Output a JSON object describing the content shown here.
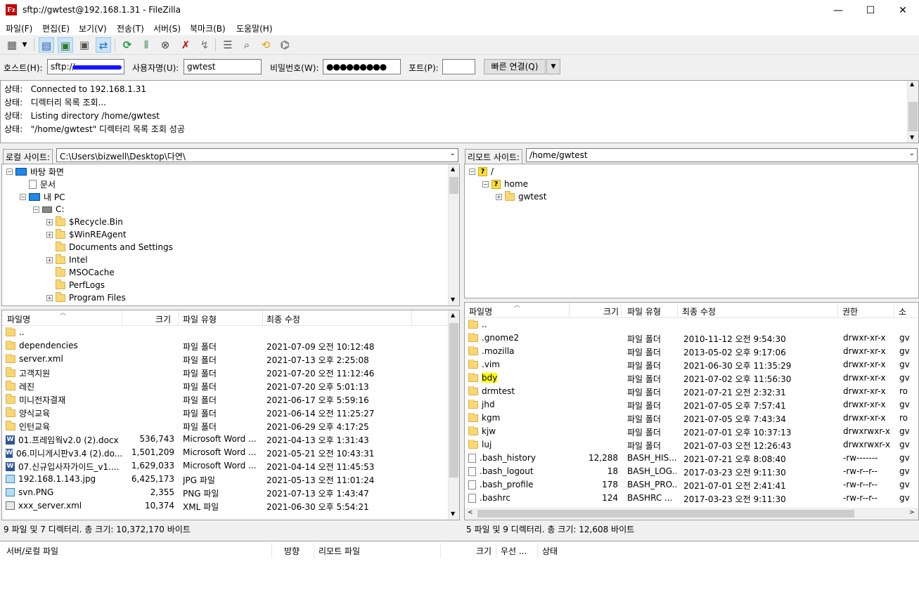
{
  "window": {
    "title": "sftp://gwtest@192.168.1.31 - FileZilla",
    "app_icon": "Fz",
    "minimize": "—",
    "maximize": "☐",
    "close": "✕"
  },
  "menu": [
    "파일(F)",
    "편집(E)",
    "보기(V)",
    "전송(T)",
    "서버(S)",
    "북마크(B)",
    "도움말(H)"
  ],
  "toolbar": [
    "site-manager-icon",
    "dropdown-icon",
    "message-log-icon",
    "local-tree-icon",
    "remote-tree-icon",
    "transfer-queue-icon",
    "refresh-icon",
    "process-queue-icon",
    "cancel-icon",
    "disconnect-icon",
    "reconnect-icon",
    "filter-icon",
    "compare-icon",
    "sync-browse-icon",
    "find-icon"
  ],
  "quickconnect": {
    "host_label": "호스트(H):",
    "host_value": "sftp://",
    "user_label": "사용자명(U):",
    "user_value": "gwtest",
    "pass_label": "비밀번호(W):",
    "pass_value": "●●●●●●●●●",
    "port_label": "포트(P):",
    "port_value": "",
    "button": "빠른 연결(Q)"
  },
  "log": [
    {
      "label": "상태:",
      "text": "Connected to 192.168.1.31"
    },
    {
      "label": "상태:",
      "text": "디렉터리 목록 조회..."
    },
    {
      "label": "상태:",
      "text": "Listing directory /home/gwtest"
    },
    {
      "label": "상태:",
      "text": "\"/home/gwtest\" 디렉터리 목록 조회 성공"
    }
  ],
  "local": {
    "site_label": "로컬 사이트:",
    "path": "C:\\Users\\bizwell\\Desktop\\다연\\",
    "tree": [
      {
        "label": "바탕 화면",
        "icon": "monitor",
        "indent": 0,
        "exp": "−"
      },
      {
        "label": "문서",
        "icon": "file",
        "indent": 1,
        "exp": ""
      },
      {
        "label": "내 PC",
        "icon": "monitor",
        "indent": 1,
        "exp": "−"
      },
      {
        "label": "C:",
        "icon": "drive",
        "indent": 2,
        "exp": "−"
      },
      {
        "label": "$Recycle.Bin",
        "icon": "folder",
        "indent": 3,
        "exp": "+"
      },
      {
        "label": "$WinREAgent",
        "icon": "folder",
        "indent": 3,
        "exp": "+"
      },
      {
        "label": "Documents and Settings",
        "icon": "folder",
        "indent": 3,
        "exp": ""
      },
      {
        "label": "Intel",
        "icon": "folder",
        "indent": 3,
        "exp": "+"
      },
      {
        "label": "MSOCache",
        "icon": "folder",
        "indent": 3,
        "exp": ""
      },
      {
        "label": "PerfLogs",
        "icon": "folder",
        "indent": 3,
        "exp": ""
      },
      {
        "label": "Program Files",
        "icon": "folder",
        "indent": 3,
        "exp": "+"
      }
    ],
    "columns": {
      "name": "파일명",
      "size": "크기",
      "type": "파일 유형",
      "modified": "최종 수정"
    },
    "files": [
      {
        "name": "..",
        "size": "",
        "type": "",
        "modified": "",
        "icon": "folder"
      },
      {
        "name": "dependencies",
        "size": "",
        "type": "파일 폴더",
        "modified": "2021-07-09 오전 10:12:48",
        "icon": "folder"
      },
      {
        "name": "server.xml",
        "size": "",
        "type": "파일 폴더",
        "modified": "2021-07-13 오후 2:25:08",
        "icon": "folder"
      },
      {
        "name": "고객지원",
        "size": "",
        "type": "파일 폴더",
        "modified": "2021-07-20 오전 11:12:46",
        "icon": "folder"
      },
      {
        "name": "레진",
        "size": "",
        "type": "파일 폴더",
        "modified": "2021-07-20 오후 5:01:13",
        "icon": "folder"
      },
      {
        "name": "미니전자결재",
        "size": "",
        "type": "파일 폴더",
        "modified": "2021-06-17 오후 5:59:16",
        "icon": "folder"
      },
      {
        "name": "양식교육",
        "size": "",
        "type": "파일 폴더",
        "modified": "2021-06-14 오전 11:25:27",
        "icon": "folder"
      },
      {
        "name": "인턴교육",
        "size": "",
        "type": "파일 폴더",
        "modified": "2021-06-29 오후 4:17:25",
        "icon": "folder"
      },
      {
        "name": "01.프레임웍v2.0 (2).docx",
        "size": "536,743",
        "type": "Microsoft Word ...",
        "modified": "2021-04-13 오후 1:31:43",
        "icon": "word"
      },
      {
        "name": "06.미니게시판v3.4 (2).do...",
        "size": "1,501,209",
        "type": "Microsoft Word ...",
        "modified": "2021-05-21 오전 10:43:31",
        "icon": "word"
      },
      {
        "name": "07.신규입사자가이드_v1....",
        "size": "1,629,033",
        "type": "Microsoft Word ...",
        "modified": "2021-04-14 오전 11:45:53",
        "icon": "word"
      },
      {
        "name": "192.168.1.143.jpg",
        "size": "6,425,173",
        "type": "JPG 파일",
        "modified": "2021-05-13 오전 11:01:24",
        "icon": "image"
      },
      {
        "name": "svn.PNG",
        "size": "2,355",
        "type": "PNG 파일",
        "modified": "2021-07-13 오후 1:43:47",
        "icon": "image"
      },
      {
        "name": "xxx_server.xml",
        "size": "10,374",
        "type": "XML 파일",
        "modified": "2021-06-30 오후 5:54:21",
        "icon": "xml"
      }
    ],
    "status": "9 파일 및 7 디렉터리. 총 크기: 10,372,170 바이트"
  },
  "remote": {
    "site_label": "리모트 사이트:",
    "path": "/home/gwtest",
    "tree": [
      {
        "label": "/",
        "icon": "q",
        "indent": 0,
        "exp": "−"
      },
      {
        "label": "home",
        "icon": "q",
        "indent": 1,
        "exp": "−"
      },
      {
        "label": "gwtest",
        "icon": "folder",
        "indent": 2,
        "exp": "+"
      }
    ],
    "columns": {
      "name": "파일명",
      "size": "크기",
      "type": "파일 유형",
      "modified": "최종 수정",
      "perms": "권한",
      "owner": "소"
    },
    "files": [
      {
        "name": "..",
        "size": "",
        "type": "",
        "modified": "",
        "perms": "",
        "owner": "",
        "icon": "folder"
      },
      {
        "name": ".gnome2",
        "size": "",
        "type": "파일 폴더",
        "modified": "2010-11-12 오전 9:54:30",
        "perms": "drwxr-xr-x",
        "owner": "gv",
        "icon": "folder"
      },
      {
        "name": ".mozilla",
        "size": "",
        "type": "파일 폴더",
        "modified": "2013-05-02 오후 9:17:06",
        "perms": "drwxr-xr-x",
        "owner": "gv",
        "icon": "folder"
      },
      {
        "name": ".vim",
        "size": "",
        "type": "파일 폴더",
        "modified": "2021-06-30 오후 11:35:29",
        "perms": "drwxr-xr-x",
        "owner": "gv",
        "icon": "folder"
      },
      {
        "name": "bdy",
        "size": "",
        "type": "파일 폴더",
        "modified": "2021-07-02 오후 11:56:30",
        "perms": "drwxr-xr-x",
        "owner": "gv",
        "icon": "folder",
        "highlight": true
      },
      {
        "name": "drmtest",
        "size": "",
        "type": "파일 폴더",
        "modified": "2021-07-21 오전 2:32:31",
        "perms": "drwxr-xr-x",
        "owner": "ro",
        "icon": "folder"
      },
      {
        "name": "jhd",
        "size": "",
        "type": "파일 폴더",
        "modified": "2021-07-05 오후 7:57:41",
        "perms": "drwxr-xr-x",
        "owner": "gv",
        "icon": "folder"
      },
      {
        "name": "kgm",
        "size": "",
        "type": "파일 폴더",
        "modified": "2021-07-05 오후 7:43:34",
        "perms": "drwxr-xr-x",
        "owner": "ro",
        "icon": "folder"
      },
      {
        "name": "kjw",
        "size": "",
        "type": "파일 폴더",
        "modified": "2021-07-01 오후 10:37:13",
        "perms": "drwxrwxr-x",
        "owner": "gv",
        "icon": "folder"
      },
      {
        "name": "luj",
        "size": "",
        "type": "파일 폴더",
        "modified": "2021-07-03 오전 12:26:43",
        "perms": "drwxrwxr-x",
        "owner": "gv",
        "icon": "folder"
      },
      {
        "name": ".bash_history",
        "size": "12,288",
        "type": "BASH_HIS...",
        "modified": "2021-07-21 오후 8:08:40",
        "perms": "-rw-------",
        "owner": "gv",
        "icon": "file"
      },
      {
        "name": ".bash_logout",
        "size": "18",
        "type": "BASH_LOG...",
        "modified": "2017-03-23 오전 9:11:30",
        "perms": "-rw-r--r--",
        "owner": "gv",
        "icon": "file"
      },
      {
        "name": ".bash_profile",
        "size": "178",
        "type": "BASH_PRO...",
        "modified": "2021-07-01 오전 2:41:41",
        "perms": "-rw-r--r--",
        "owner": "gv",
        "icon": "file"
      },
      {
        "name": ".bashrc",
        "size": "124",
        "type": "BASHRC ...",
        "modified": "2017-03-23 오전 9:11:30",
        "perms": "-rw-r--r--",
        "owner": "gv",
        "icon": "file"
      }
    ],
    "status": "5 파일 및 9 디렉터리. 총 크기: 12,608 바이트"
  },
  "queue": {
    "columns": {
      "local": "서버/로컬 파일",
      "direction": "방향",
      "remote": "리모트 파일",
      "size": "크기",
      "priority": "우선 ...",
      "status": "상태"
    }
  }
}
